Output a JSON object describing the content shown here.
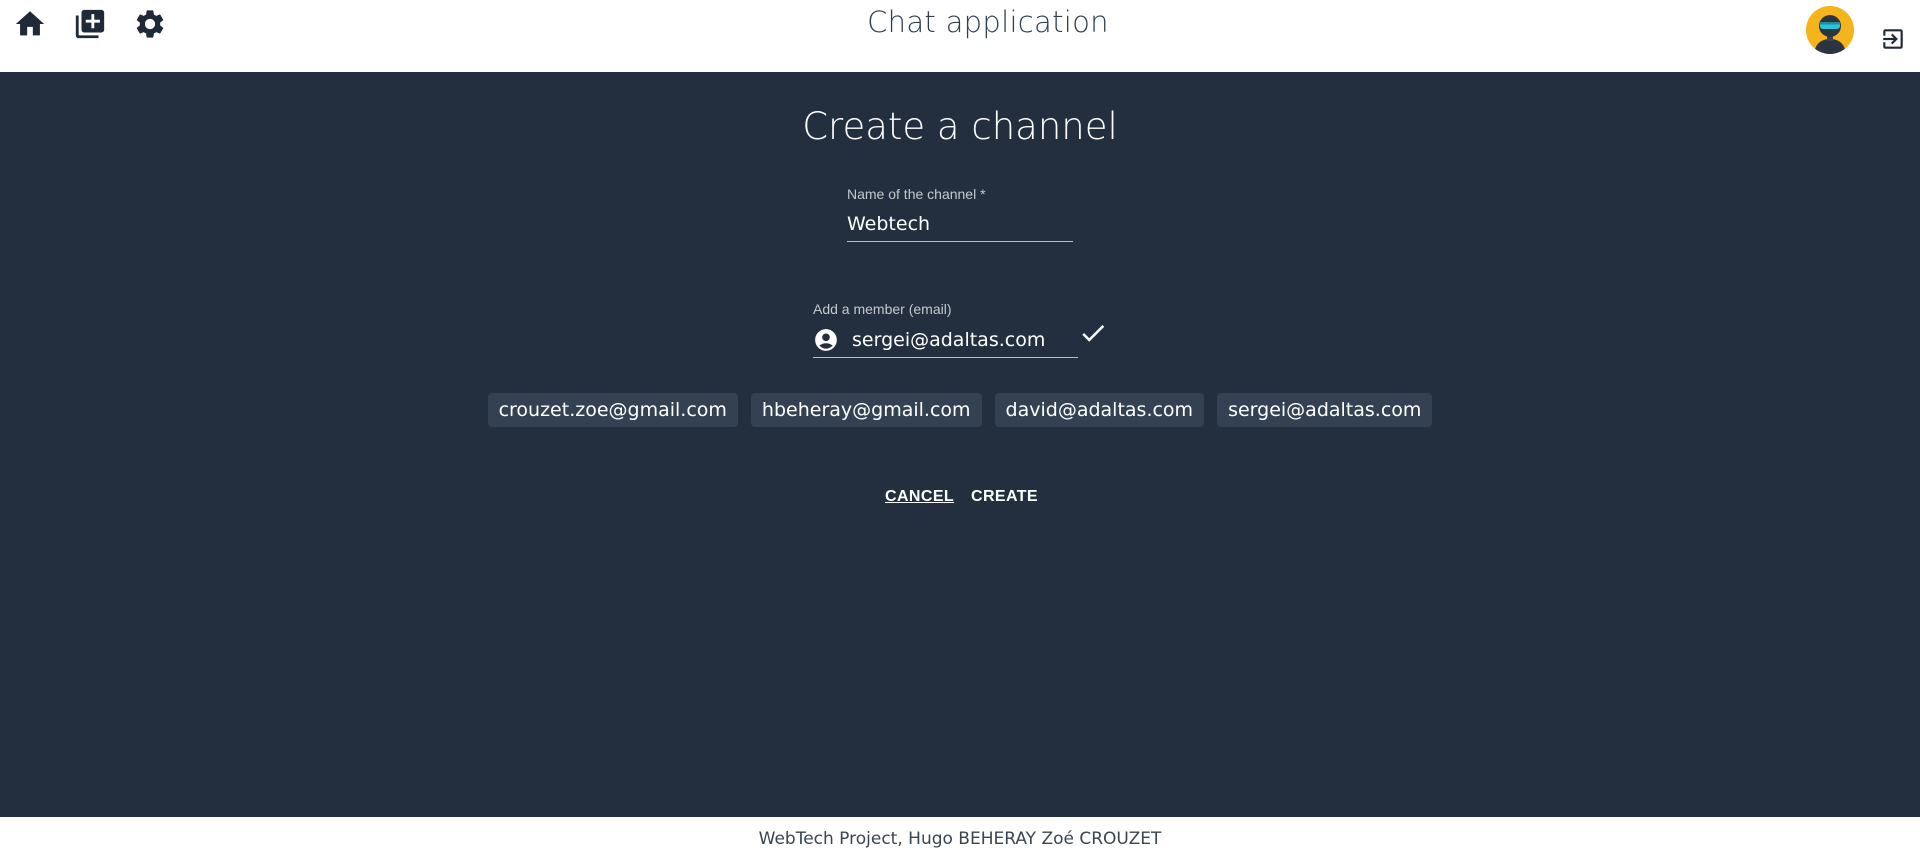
{
  "header": {
    "title": "Chat application",
    "icons": [
      "home-icon",
      "add-channel-icon",
      "settings-icon",
      "avatar",
      "logout-icon"
    ]
  },
  "form": {
    "title": "Create a channel",
    "channel_name": {
      "label": "Name of the channel *",
      "value": "Webtech"
    },
    "member": {
      "label": "Add a member (email)",
      "value": "sergei@adaltas.com"
    },
    "members": [
      "crouzet.zoe@gmail.com",
      "hbeheray@gmail.com",
      "david@adaltas.com",
      "sergei@adaltas.com"
    ],
    "cancel_label": "CANCEL",
    "create_label": "CREATE"
  },
  "footer": {
    "text": "WebTech Project, Hugo BEHERAY Zoé CROUZET"
  },
  "colors": {
    "header_bg": "#ffffff",
    "main_bg": "#232f3e",
    "chip_bg": "#344152",
    "icon_dark": "#1f2a38",
    "avatar_bg": "#f6b41c"
  }
}
